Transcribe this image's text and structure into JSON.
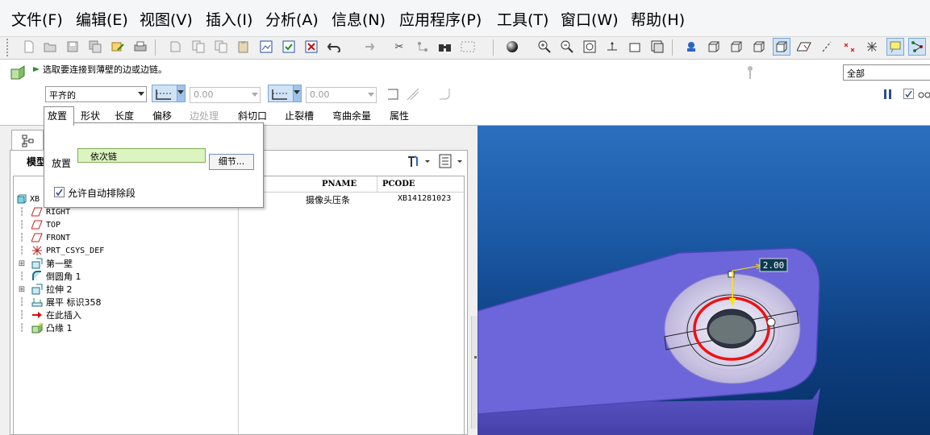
{
  "menu": [
    "文件(F)",
    "编辑(E)",
    "视图(V)",
    "插入(I)",
    "分析(A)",
    "信息(N)",
    "应用程序(P)",
    "工具(T)",
    "窗口(W)",
    "帮助(H)"
  ],
  "status_message": "选取要连接到薄壁的边或边链。",
  "filter": {
    "value": "全部"
  },
  "dashboard": {
    "shape_select": "平齐的",
    "value1": "0.00",
    "value2": "0.00",
    "tabs": [
      "放置",
      "形状",
      "长度",
      "偏移",
      "边处理",
      "斜切口",
      "止裂槽",
      "弯曲余量",
      "属性"
    ],
    "disabled_tabs": [
      "边处理"
    ]
  },
  "flyout": {
    "label": "放置",
    "chain": "依次链",
    "details_button": "细节...",
    "checkbox_label": "允许自动排除段",
    "checkbox_checked": true
  },
  "model_tree": {
    "header_label": "模型",
    "columns": [
      "PNAME",
      "PCODE"
    ],
    "root": {
      "name": "XB",
      "pname": "摄像头压条",
      "pcode": "XB141281023"
    },
    "items": [
      {
        "label": "RIGHT",
        "icon": "datum-plane-icon",
        "mono": true
      },
      {
        "label": "TOP",
        "icon": "datum-plane-icon",
        "mono": true
      },
      {
        "label": "FRONT",
        "icon": "datum-plane-icon",
        "mono": true
      },
      {
        "label": "PRT_CSYS_DEF",
        "icon": "csys-icon",
        "mono": true
      },
      {
        "label": "第一壁",
        "icon": "wall-icon",
        "mono": false,
        "expand": true
      },
      {
        "label": "倒圆角 1",
        "icon": "round-icon",
        "mono": false
      },
      {
        "label": "拉伸 2",
        "icon": "extrude-icon",
        "mono": false,
        "expand": true
      },
      {
        "label": "展平 标识358",
        "icon": "unbend-icon",
        "mono": false
      },
      {
        "label": "在此插入",
        "icon": "insert-here-arrow-icon",
        "mono": false
      },
      {
        "label": "凸缘 1",
        "icon": "flange-icon",
        "mono": false
      }
    ]
  },
  "viewport": {
    "dimension_label": "2.00"
  },
  "colors": {
    "part": "#6a64d8",
    "highlight": "#ff1010",
    "background_top": "#2b6fbe",
    "background_bottom": "#083268"
  }
}
